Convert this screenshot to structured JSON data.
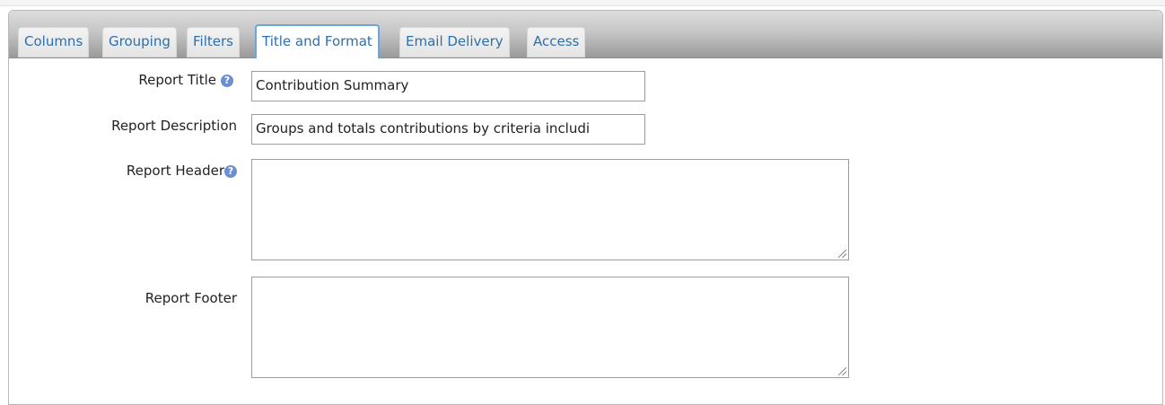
{
  "tabs": [
    {
      "label": "Columns",
      "active": false
    },
    {
      "label": "Grouping",
      "active": false
    },
    {
      "label": "Filters",
      "active": false
    },
    {
      "label": "Title and Format",
      "active": true
    },
    {
      "label": "Email Delivery",
      "active": false
    },
    {
      "label": "Access",
      "active": false
    }
  ],
  "form": {
    "report_title": {
      "label": "Report Title",
      "value": "Contribution Summary",
      "help_icon": "question-circle-icon"
    },
    "report_description": {
      "label": "Report Description",
      "value": "Groups and totals contributions by criteria includi"
    },
    "report_header": {
      "label": "Report Header",
      "value": "",
      "help_icon": "question-circle-icon"
    },
    "report_footer": {
      "label": "Report Footer",
      "value": ""
    }
  },
  "colors": {
    "tab_text": "#2e6fad",
    "active_tab_border": "#6aa7de",
    "help_icon": "#6c8fd4"
  }
}
